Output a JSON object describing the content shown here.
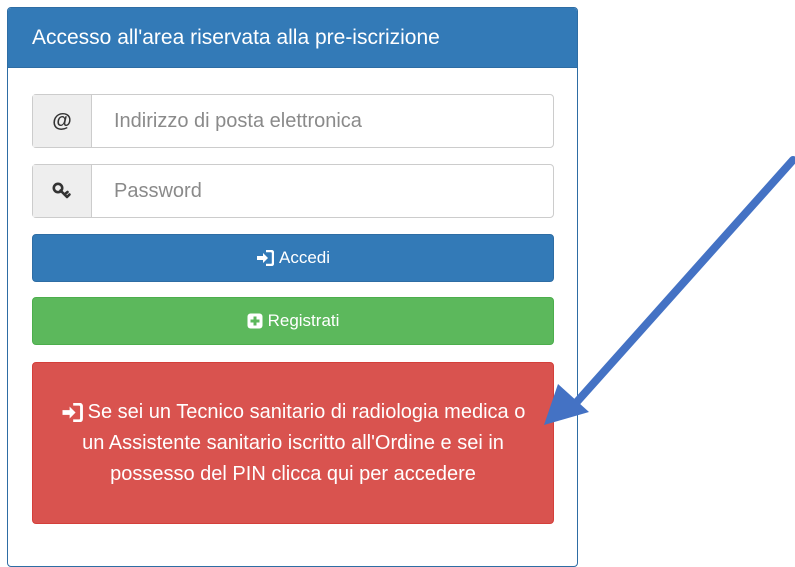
{
  "panel": {
    "title": "Accesso all'area riservata alla pre-iscrizione"
  },
  "email": {
    "addon": "@",
    "placeholder": "Indirizzo di posta elettronica",
    "value": ""
  },
  "password": {
    "addon_icon": "key-icon",
    "placeholder": "Password",
    "value": ""
  },
  "buttons": {
    "accedi_label": "Accedi",
    "accedi_icon": "login-icon",
    "registrati_label": "Registrati",
    "registrati_icon": "plus-square-icon",
    "pin_label": "Se sei un Tecnico sanitario di radiologia medica o un Assistente sanitario iscritto all'Ordine e sei in possesso del PIN clicca qui per accedere",
    "pin_icon": "login-icon"
  },
  "colors": {
    "primary": "#337ab7",
    "success": "#5cb85c",
    "danger": "#d9534f",
    "arrow": "#4472c4"
  }
}
